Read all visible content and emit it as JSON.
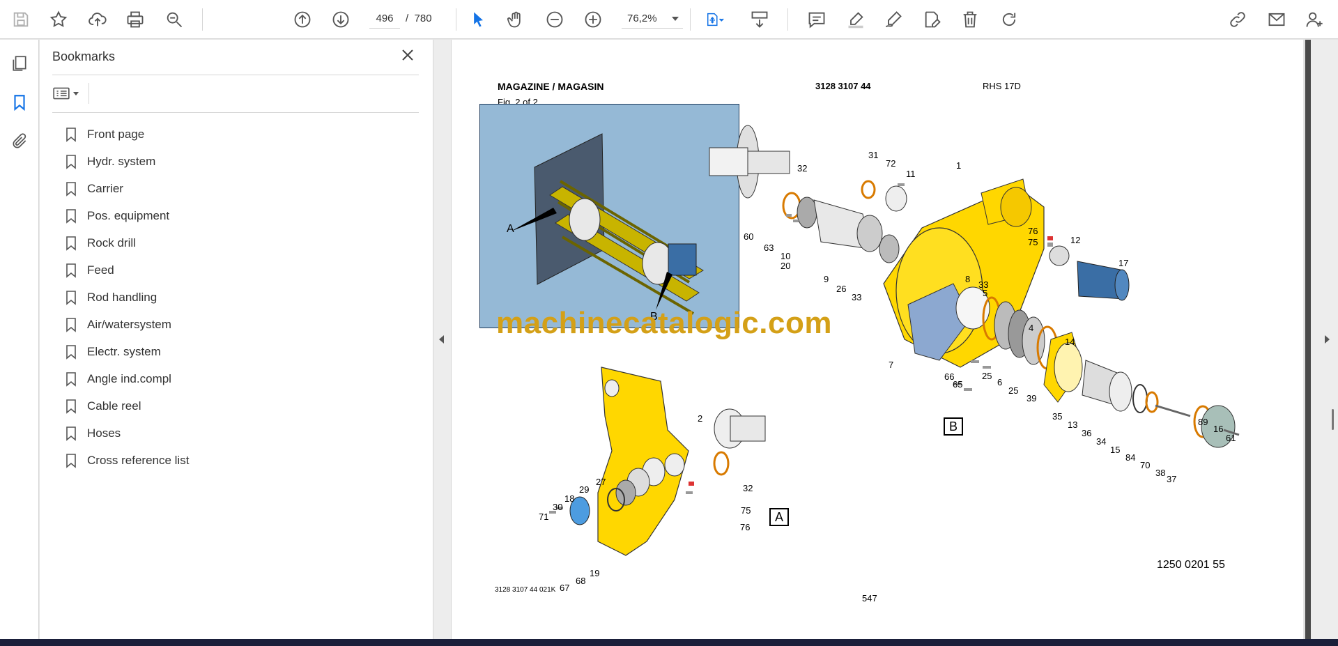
{
  "toolbar": {
    "current_page": "496",
    "page_separator": "/",
    "page_total": "780",
    "zoom": "76,2%"
  },
  "bookmarks": {
    "title": "Bookmarks",
    "items": [
      "Front page",
      "Hydr. system",
      "Carrier",
      "Pos. equipment",
      "Rock drill",
      "Feed",
      "Rod handling",
      "Air/watersystem",
      "Electr. system",
      "Angle ind.compl",
      "Cable reel",
      "Hoses",
      "Cross reference list"
    ]
  },
  "document": {
    "header_title": "MAGAZINE / MAGASIN",
    "header_part": "3128 3107 44",
    "header_model": "RHS 17D",
    "fig_label": "Fig. 2 of 2",
    "watermark": "machinecatalogic.com",
    "inset_label_a": "A",
    "inset_label_b": "B",
    "view_label_a": "A",
    "view_label_b": "B",
    "drawing_number": "1250 0201 55",
    "footer_code": "3128 3107 44  021K",
    "page_number": "547",
    "part_numbers_b": [
      "31",
      "72",
      "11",
      "1",
      "32",
      "60",
      "63",
      "10",
      "20",
      "9",
      "26",
      "33",
      "76",
      "75",
      "12",
      "17",
      "8",
      "33",
      "5",
      "4",
      "14",
      "7",
      "66",
      "65",
      "25",
      "6",
      "25",
      "39",
      "35",
      "13",
      "36",
      "34",
      "15",
      "84",
      "70",
      "38",
      "37",
      "89",
      "16",
      "61"
    ],
    "part_numbers_a": [
      "2",
      "32",
      "75",
      "76",
      "27",
      "29",
      "18",
      "30",
      "71",
      "19",
      "68",
      "67"
    ]
  }
}
